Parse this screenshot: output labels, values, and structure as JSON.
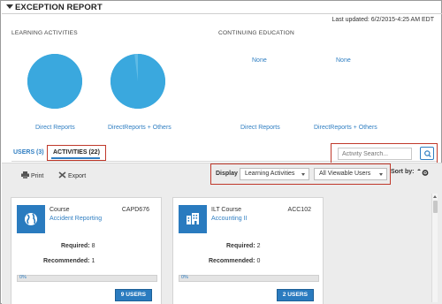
{
  "header": {
    "title": "EXCEPTION REPORT",
    "last_updated": "Last updated: 6/2/2015-4:25 AM EDT"
  },
  "sections": {
    "learning": {
      "label": "LEARNING ACTIVITIES",
      "charts": [
        {
          "caption": "Direct Reports"
        },
        {
          "caption": "DirectReports + Others"
        }
      ]
    },
    "continuing": {
      "label": "CONTINUING EDUCATION",
      "items": [
        {
          "value": "None",
          "caption": "Direct Reports"
        },
        {
          "value": "None",
          "caption": "DirectReports + Others"
        }
      ]
    }
  },
  "chart_data": [
    {
      "type": "pie",
      "title": "",
      "slices": [
        {
          "value": 100
        }
      ],
      "colors": [
        "#3aa8de"
      ]
    },
    {
      "type": "pie",
      "title": "",
      "slices": [
        {
          "value": 98
        },
        {
          "value": 2
        }
      ],
      "colors": [
        "#3aa8de",
        "#5fbbe6"
      ]
    }
  ],
  "tabs": {
    "users": "USERS (3)",
    "activities": "ACTIVITIES (22)"
  },
  "search": {
    "placeholder": "Activity Search..."
  },
  "toolbar": {
    "print_label": "Print",
    "export_label": "Export",
    "display_label": "Display",
    "display_select": "Learning Activities",
    "users_select": "All Viewable Users",
    "sort_label": "Sort by:"
  },
  "cards": [
    {
      "type": "Course",
      "name": "Accident Reporting",
      "code": "CAPD676",
      "required_label": "Required:",
      "required_value": "8",
      "recommended_label": "Recommended:",
      "recommended_value": "1",
      "progress_text": "0%",
      "progress": 0,
      "users_button": "9 USERS",
      "icon": "globe-icon"
    },
    {
      "type": "ILT Course",
      "name": "Accounting II",
      "code": "ACC102",
      "required_label": "Required:",
      "required_value": "2",
      "recommended_label": "Recommended:",
      "recommended_value": "0",
      "progress_text": "0%",
      "progress": 0,
      "users_button": "2 USERS",
      "icon": "building-icon"
    }
  ]
}
